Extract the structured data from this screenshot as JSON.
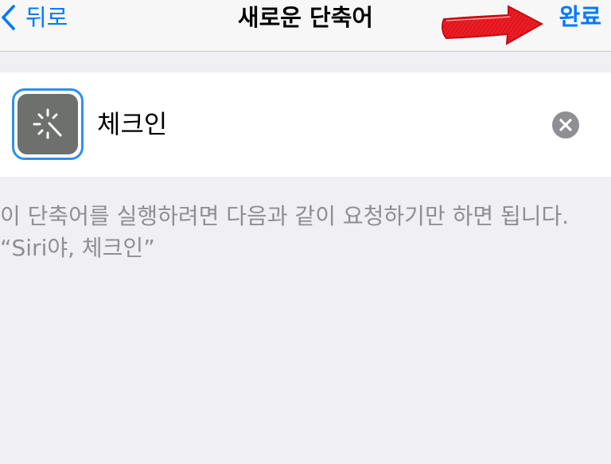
{
  "navbar": {
    "back_label": "뒤로",
    "title": "새로운 단축어",
    "done_label": "완료"
  },
  "shortcut": {
    "name": "체크인",
    "icon": "magic-wand-icon",
    "icon_color": "#6e706d"
  },
  "description": "이 단축어를 실행하려면 다음과 같이 요청하기만 하면 됩니다. “Siri야, 체크인”",
  "colors": {
    "accent": "#007aff",
    "background": "#efeff4",
    "annotation_arrow": "#e8141c"
  }
}
